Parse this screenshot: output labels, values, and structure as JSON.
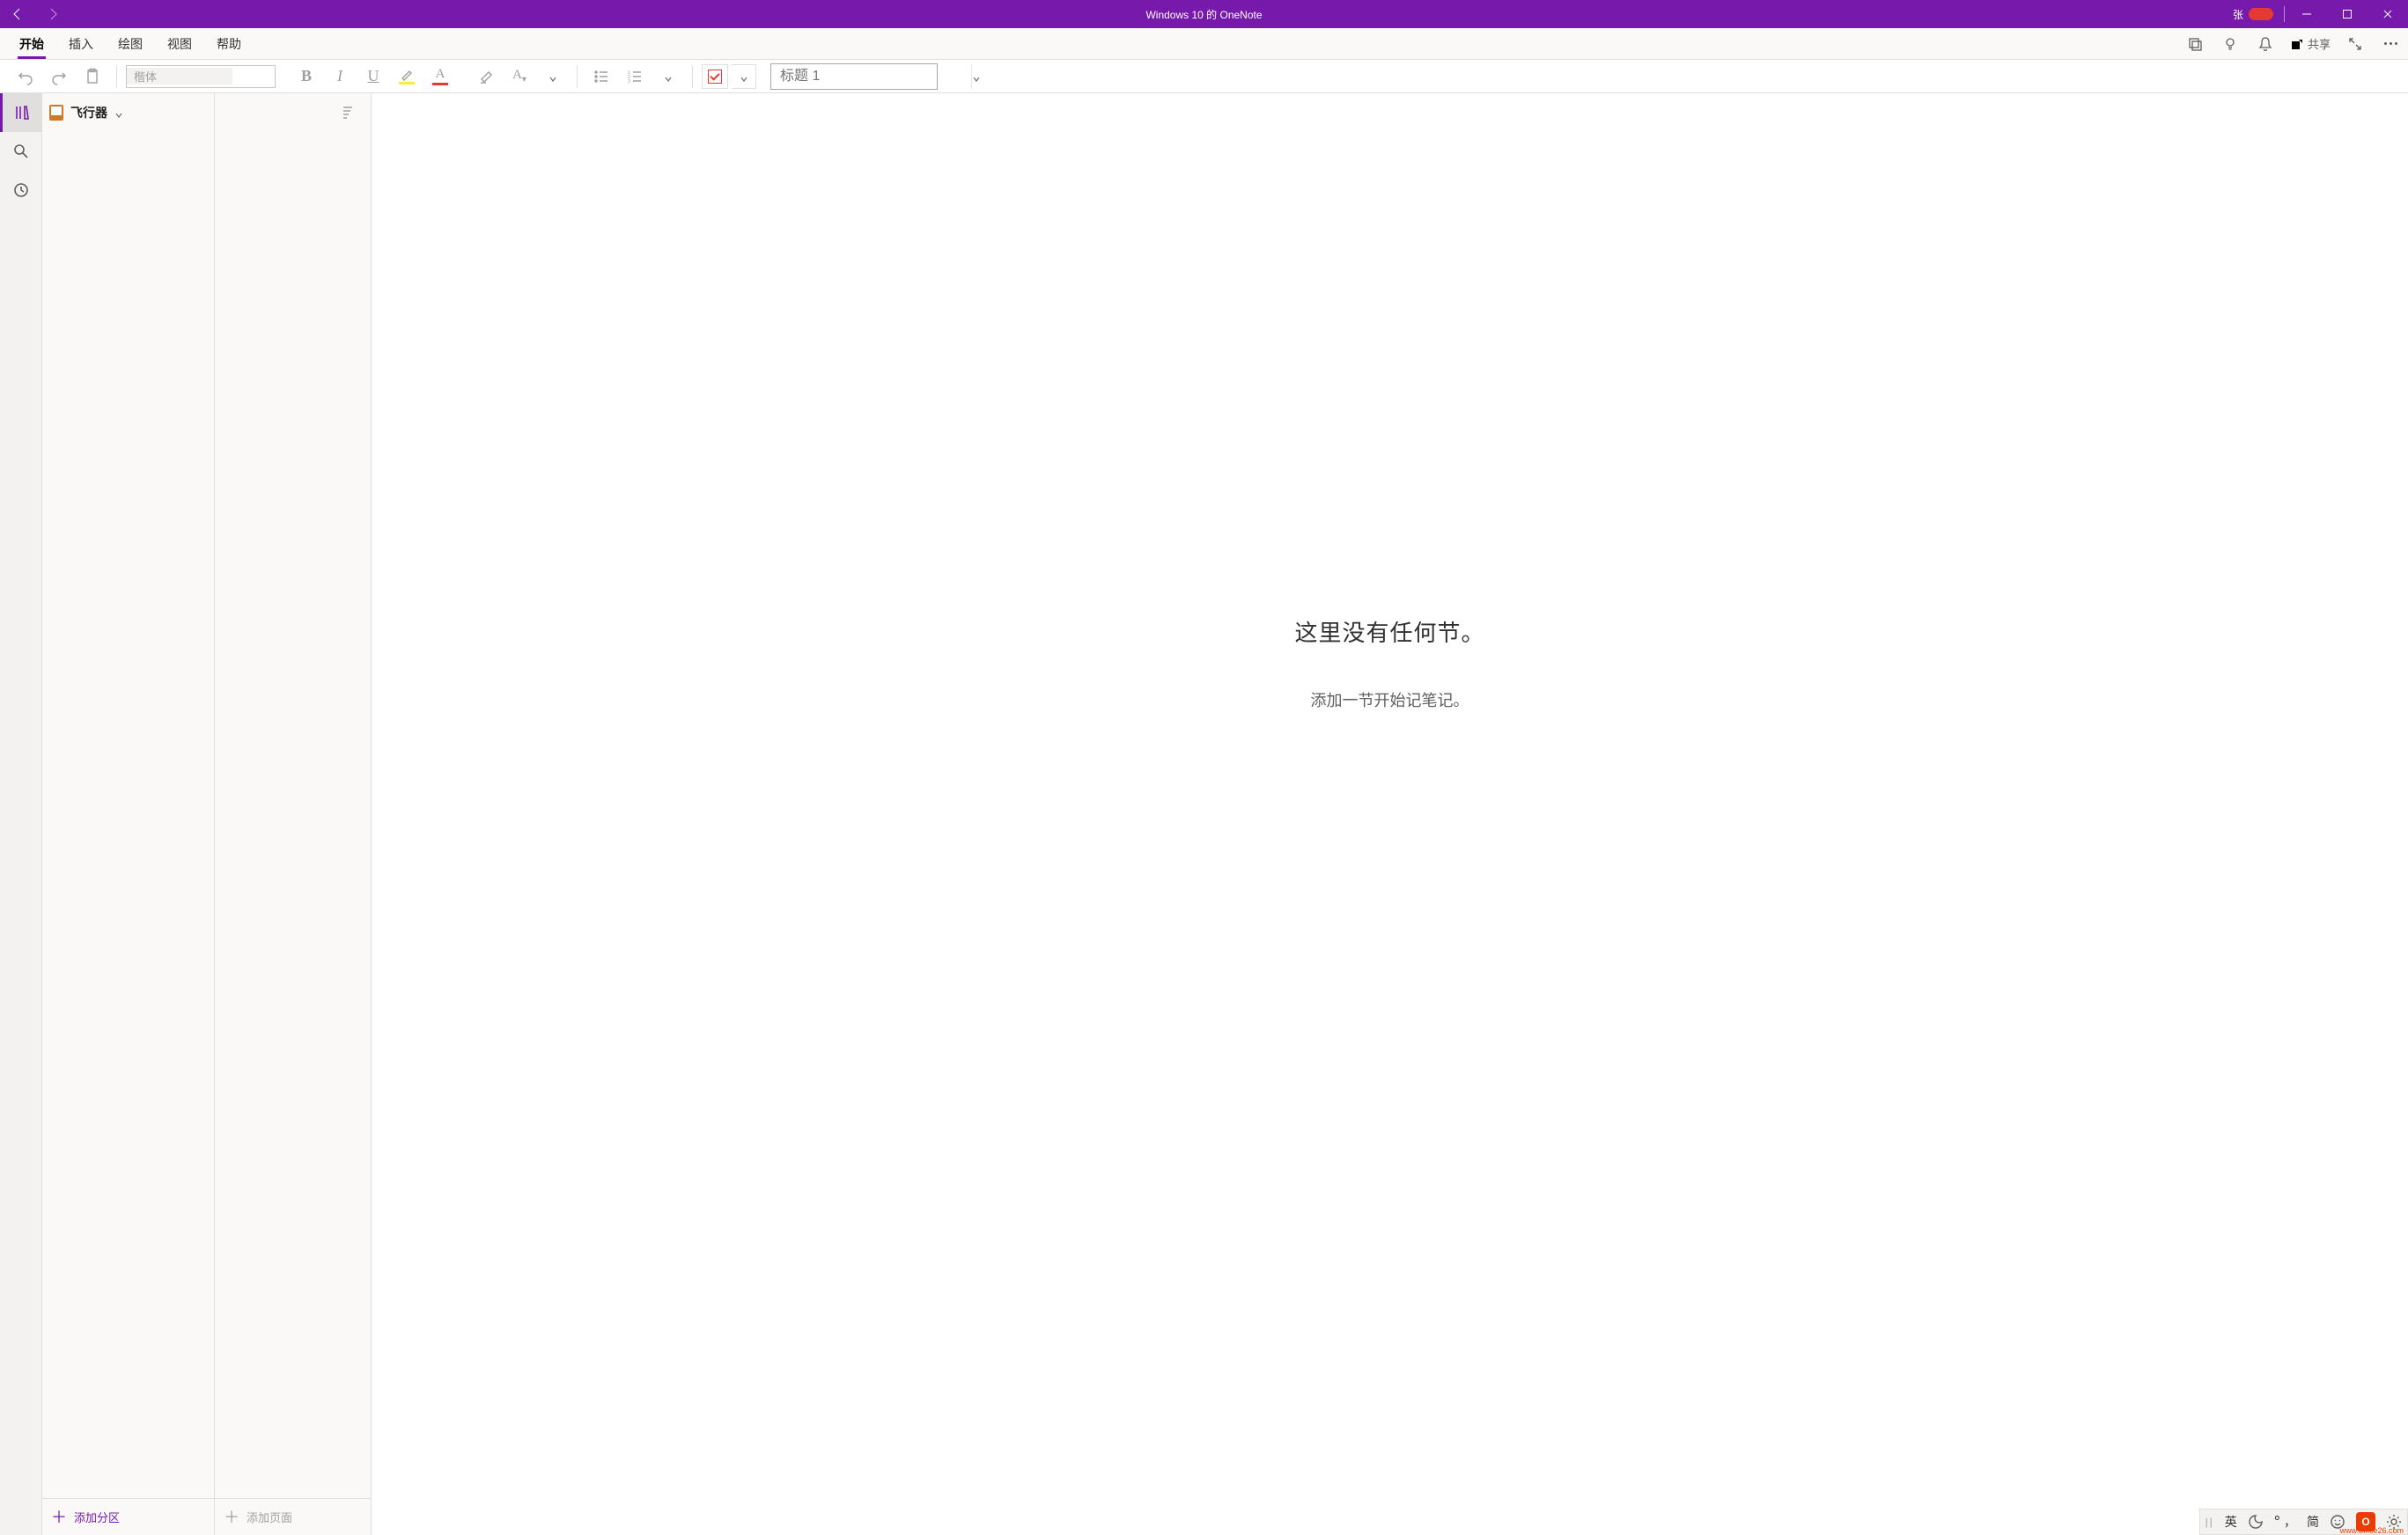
{
  "titlebar": {
    "app_title": "Windows 10 的 OneNote",
    "user_name": "张"
  },
  "menu": {
    "tabs": [
      "开始",
      "插入",
      "绘图",
      "视图",
      "帮助"
    ],
    "active_index": 0,
    "share_label": "共享"
  },
  "ribbon": {
    "font_placeholder": "楷体",
    "style_placeholder": "标题 1"
  },
  "notebook": {
    "name": "飞行器"
  },
  "sections": {
    "add_label": "添加分区"
  },
  "pages": {
    "add_label": "添加页面"
  },
  "canvas": {
    "empty_title": "这里没有任何节。",
    "empty_sub": "添加一节开始记笔记。"
  },
  "tray": {
    "ime_lang": "英",
    "ime_punct": "，",
    "ime_simp": "简",
    "office_badge": "O",
    "watermark": "www.office26.com"
  }
}
